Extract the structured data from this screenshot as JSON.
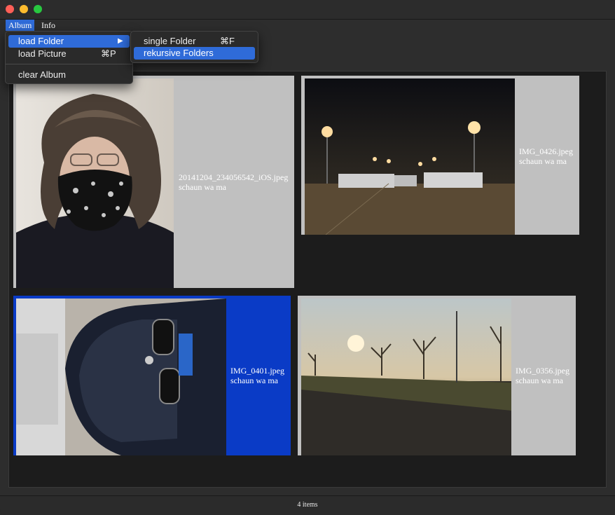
{
  "menubar": {
    "album": "Album",
    "info": "Info"
  },
  "album_menu": {
    "load_folder": "load Folder",
    "submenu_arrow": "▶",
    "load_picture": "load Picture",
    "load_picture_shortcut": "⌘P",
    "clear_album": "clear Album"
  },
  "submenu": {
    "single_folder": "single Folder",
    "single_folder_shortcut": "⌘F",
    "recursive_folders": "rekursive Folders"
  },
  "items": [
    {
      "filename": "20141204_234056542_iOS.jpeg",
      "author": "schaun wa ma"
    },
    {
      "filename": "IMG_0426.jpeg",
      "author": "schaun wa ma"
    },
    {
      "filename": "IMG_0401.jpeg",
      "author": "schaun wa ma"
    },
    {
      "filename": "IMG_0356.jpeg",
      "author": "schaun wa ma"
    }
  ],
  "status": {
    "count": "4 items"
  },
  "colors": {
    "selection": "#0a3bc6",
    "card": "#c0c0c0",
    "menu_highlight": "#2f6bd8"
  }
}
